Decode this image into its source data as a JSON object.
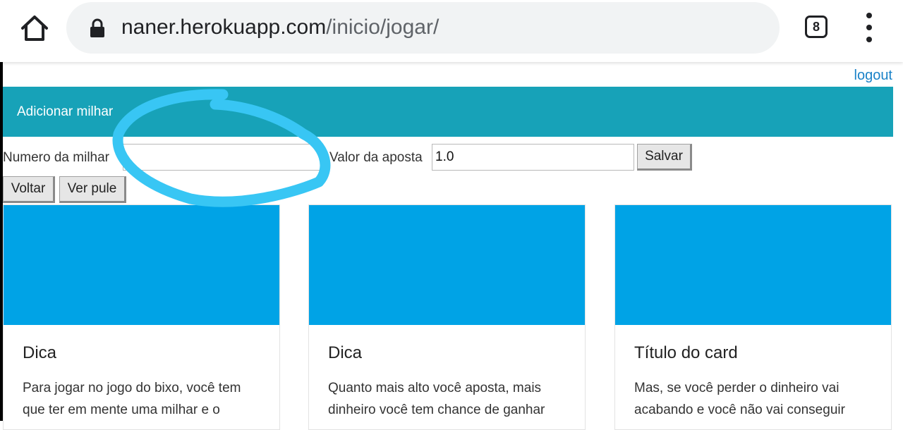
{
  "browser": {
    "url_host": "naner.herokuapp.com",
    "url_path": "/inicio/jogar/",
    "tab_count": "8",
    "icons": {
      "home": "home-icon",
      "lock": "lock-icon",
      "menu": "more-vert-icon"
    }
  },
  "page": {
    "logout": "logout",
    "section_title": "Adicionar milhar",
    "form": {
      "numero_label": "Numero da milhar",
      "numero_value": "",
      "valor_label": "Valor da aposta",
      "valor_value": "1.0",
      "save_label": "Salvar",
      "back_label": "Voltar",
      "pule_label": "Ver pule"
    },
    "cards": [
      {
        "title": "Dica",
        "text": "Para jogar no jogo do bixo, você tem que ter em mente uma milhar e o"
      },
      {
        "title": "Dica",
        "text": "Quanto mais alto você aposta, mais dinheiro você tem chance de ganhar"
      },
      {
        "title": "Título do card",
        "text": "Mas, se você perder o dinheiro vai acabando e você não vai conseguir"
      }
    ]
  },
  "colors": {
    "bar": "#17a2b8",
    "card_image": "#00a3e6",
    "link": "#1a82c8",
    "annotation": "#38c6f4"
  }
}
